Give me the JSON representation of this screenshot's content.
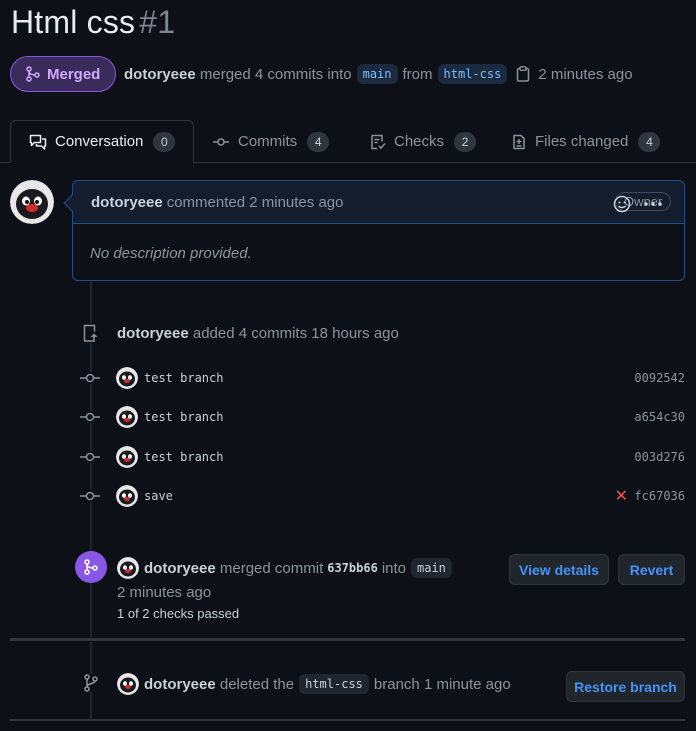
{
  "pr": {
    "title": "Html css",
    "number": "#1",
    "state_label": "Merged",
    "author": "dotoryeee",
    "merged_text": "merged 4 commits into",
    "base_branch": "main",
    "from_text": "from",
    "head_branch": "html-css",
    "time": "2 minutes ago"
  },
  "tabs": [
    {
      "label": "Conversation",
      "count": "0",
      "icon": "comment-discussion-icon"
    },
    {
      "label": "Commits",
      "count": "4",
      "icon": "git-commit-icon"
    },
    {
      "label": "Checks",
      "count": "2",
      "icon": "checklist-icon"
    },
    {
      "label": "Files changed",
      "count": "4",
      "icon": "file-diff-icon"
    }
  ],
  "comment": {
    "author": "dotoryeee",
    "meta": "commented 2 minutes ago",
    "badge": "Owner",
    "body": "No description provided."
  },
  "commits_event": {
    "author": "dotoryeee",
    "text": "added 4 commits",
    "time": "18 hours ago"
  },
  "commits": [
    {
      "message": "test branch",
      "sha": "0092542",
      "failed": false
    },
    {
      "message": "test branch",
      "sha": "a654c30",
      "failed": false
    },
    {
      "message": "test branch",
      "sha": "003d276",
      "failed": false
    },
    {
      "message": "save",
      "sha": "fc67036",
      "failed": true
    }
  ],
  "merge_event": {
    "author": "dotoryeee",
    "text": "merged commit",
    "commit": "637bb66",
    "into": "into",
    "branch": "main",
    "time": "2 minutes ago",
    "checks": "1 of 2 checks passed",
    "view_details_label": "View details",
    "revert_label": "Revert"
  },
  "delete_event": {
    "author": "dotoryeee",
    "text": "deleted the",
    "branch": "html-css",
    "suffix": "branch",
    "time": "1 minute ago",
    "restore_label": "Restore branch"
  },
  "colors": {
    "background": "#0d1117",
    "merged_purple": "#8957e5",
    "link_blue": "#4493f8",
    "fail_red": "#f85149"
  }
}
